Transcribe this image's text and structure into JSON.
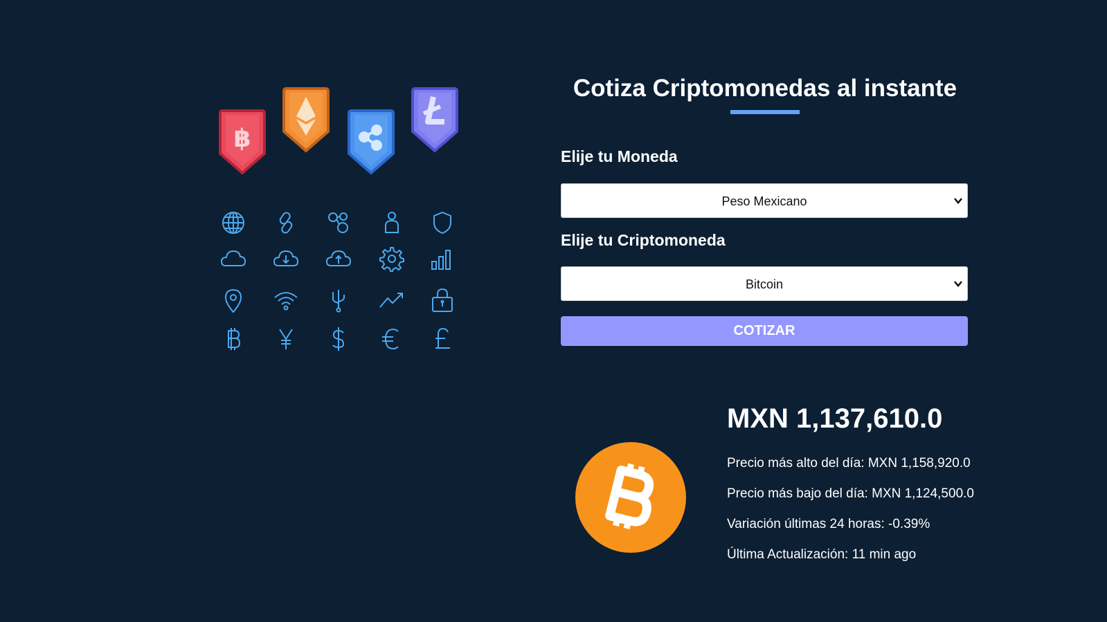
{
  "form": {
    "title": "Cotiza Criptomonedas al instante",
    "currency_label": "Elije tu Moneda",
    "currency_selected": "Peso Mexicano",
    "crypto_label": "Elije tu Criptomoneda",
    "crypto_selected": "Bitcoin",
    "submit_label": "Cotizar"
  },
  "result": {
    "price": "MXN 1,137,610.0",
    "high": "Precio más alto del día: MXN 1,158,920.0",
    "low": "Precio más bajo del día: MXN 1,124,500.0",
    "change": "Variación últimas 24 horas: -0.39%",
    "updated": "Última Actualización: 11 min ago"
  },
  "hero_badges": [
    {
      "icon": "bitcoin-icon",
      "color": "#e9495c"
    },
    {
      "icon": "ethereum-icon",
      "color": "#f18d33"
    },
    {
      "icon": "ripple-icon",
      "color": "#4a92ef"
    },
    {
      "icon": "litecoin-icon",
      "color": "#7d7cf0"
    }
  ],
  "hero_icons": [
    "globe-icon",
    "link-icon",
    "nodes-icon",
    "user-icon",
    "shield-icon",
    "cloud-icon",
    "cloud-download-icon",
    "cloud-upload-icon",
    "gear-icon",
    "bar-chart-icon",
    "location-pin-icon",
    "wifi-icon",
    "usb-icon",
    "trend-up-icon",
    "lock-icon",
    "bitcoin-icon",
    "yen-icon",
    "dollar-icon",
    "euro-icon",
    "pound-icon"
  ],
  "colors": {
    "background": "#0c1f33",
    "accent_underline": "#66a2fe",
    "button": "#9497ff",
    "icon_stroke": "#4ca9ef",
    "bitcoin_orange": "#f7931a"
  }
}
